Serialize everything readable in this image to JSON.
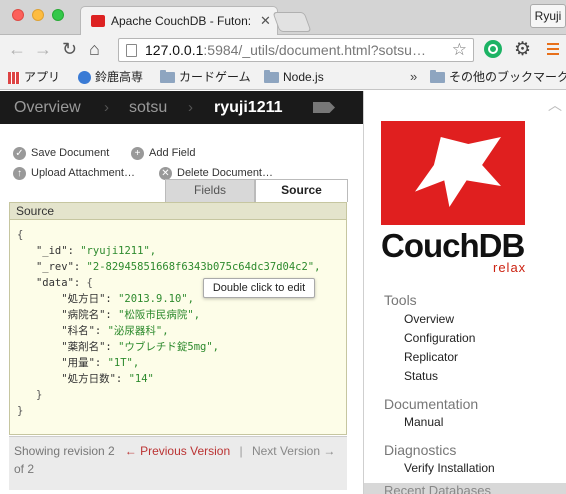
{
  "browser": {
    "tab_title": "Apache CouchDB - Futon: ",
    "profile_name": "Ryuji",
    "url_host": "127.0.0.1",
    "url_path": ":5984/_utils/document.html?sotsu…",
    "bookmarks": [
      {
        "label": "アプリ",
        "icon": "apps-grid-icon"
      },
      {
        "label": "鈴鹿高専",
        "icon": "globe-icon"
      },
      {
        "label": "カードゲーム",
        "icon": "folder-icon"
      },
      {
        "label": "Node.js",
        "icon": "folder-icon"
      },
      {
        "label": "その他のブックマーク",
        "icon": "folder-icon"
      }
    ],
    "more_bookmarks": "»"
  },
  "breadcrumb": {
    "overview": "Overview",
    "database": "sotsu",
    "document": "ryuji1211"
  },
  "actions": {
    "save": "Save Document",
    "add_field": "Add Field",
    "upload": "Upload Attachment…",
    "delete": "Delete Document…"
  },
  "tabs": {
    "fields": "Fields",
    "source": "Source"
  },
  "source": {
    "header": "Source",
    "tooltip": "Double click to edit",
    "lines": [
      {
        "indent": "",
        "key": "",
        "text": "{"
      },
      {
        "indent": "   ",
        "key": "\"_id\": ",
        "text": "\"ryuji1211\","
      },
      {
        "indent": "   ",
        "key": "\"_rev\": ",
        "text": "\"2-82945851668f6343b075c64dc37d04c2\","
      },
      {
        "indent": "   ",
        "key": "\"data\": ",
        "text": "{"
      },
      {
        "indent": "       ",
        "key": "\"処方日\": ",
        "text": "\"2013.9.10\","
      },
      {
        "indent": "       ",
        "key": "\"病院名\": ",
        "text": "\"松阪市民病院\","
      },
      {
        "indent": "       ",
        "key": "\"科名\": ",
        "text": "\"泌尿器科\","
      },
      {
        "indent": "       ",
        "key": "\"薬剤名\": ",
        "text": "\"ウブレチド錠5mg\","
      },
      {
        "indent": "       ",
        "key": "\"用量\": ",
        "text": "\"1T\","
      },
      {
        "indent": "       ",
        "key": "\"処方日数\": ",
        "text": "\"14\""
      },
      {
        "indent": "   ",
        "key": "",
        "text": "}"
      },
      {
        "indent": "",
        "key": "",
        "text": "}"
      }
    ]
  },
  "footer": {
    "showing": "Showing revision 2",
    "prev": "← Previous Version",
    "separator": "|",
    "next": "Next Version →",
    "of": "of 2"
  },
  "sidebar": {
    "logo_text": "CouchDB",
    "logo_tag": "relax",
    "tools_heading": "Tools",
    "tools": [
      "Overview",
      "Configuration",
      "Replicator",
      "Status"
    ],
    "documentation_heading": "Documentation",
    "documentation": [
      "Manual"
    ],
    "diagnostics_heading": "Diagnostics",
    "diagnostics": [
      "Verify Installation"
    ],
    "recent_heading": "Recent Databases"
  },
  "colors": {
    "couchdb_red": "#e01f1f",
    "breadcrumb_bg": "#1a1a1a",
    "source_bg": "#fdfde8",
    "string_green": "#2d8a2d",
    "link_red": "#b33"
  }
}
